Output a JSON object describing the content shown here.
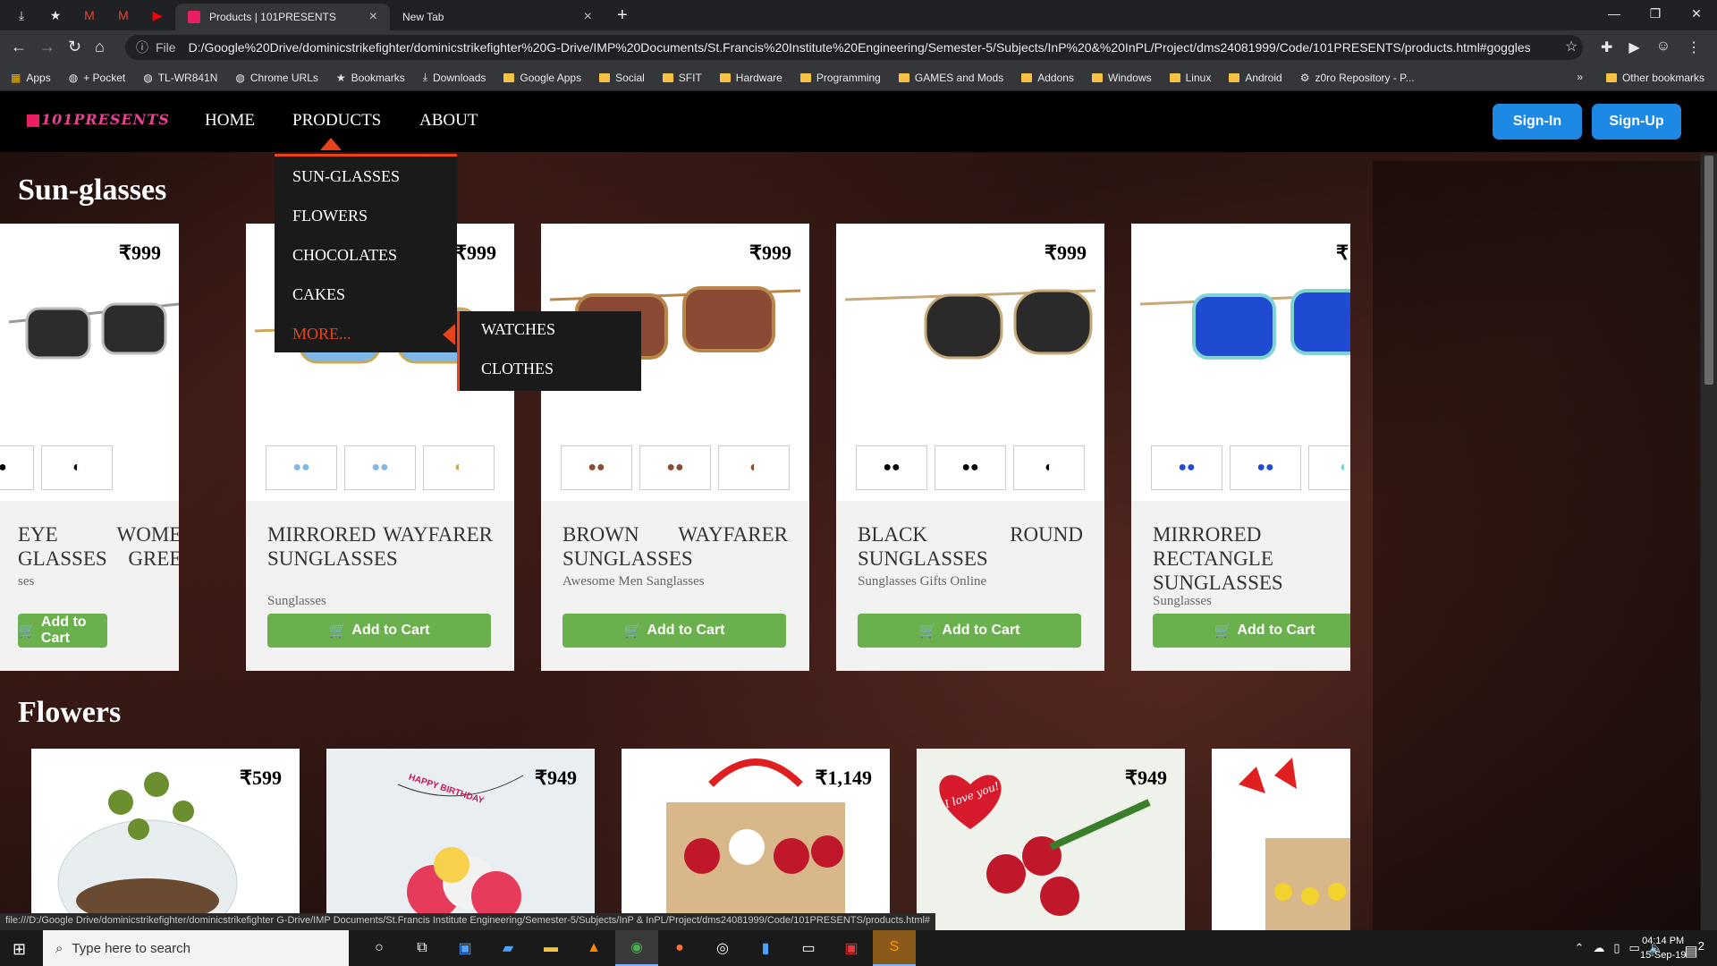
{
  "browser": {
    "tabs": [
      {
        "title": "Products | 101PRESENTS"
      },
      {
        "title": "New Tab"
      }
    ],
    "address": {
      "scheme_label": "File",
      "url": "D:/Google%20Drive/dominicstrikefighter/dominicstrikefighter%20G-Drive/IMP%20Documents/St.Francis%20Institute%20Engineering/Semester-5/Subjects/InP%20&%20InPL/Project/dms24081999/Code/101PRESENTS/products.html#goggles"
    },
    "bookmarks": [
      {
        "label": "Apps",
        "icon": "apps-grid-icon"
      },
      {
        "label": "+ Pocket",
        "icon": "globe-icon"
      },
      {
        "label": "TL-WR841N",
        "icon": "globe-icon"
      },
      {
        "label": "Chrome URLs",
        "icon": "globe-icon"
      },
      {
        "label": "Bookmarks",
        "icon": "star-icon"
      },
      {
        "label": "Downloads",
        "icon": "download-icon"
      },
      {
        "label": "Google Apps",
        "icon": "folder-icon"
      },
      {
        "label": "Social",
        "icon": "folder-icon"
      },
      {
        "label": "SFIT",
        "icon": "folder-icon"
      },
      {
        "label": "Hardware",
        "icon": "folder-icon"
      },
      {
        "label": "Programming",
        "icon": "folder-icon"
      },
      {
        "label": "GAMES and Mods",
        "icon": "folder-icon"
      },
      {
        "label": "Addons",
        "icon": "folder-icon"
      },
      {
        "label": "Windows",
        "icon": "folder-icon"
      },
      {
        "label": "Linux",
        "icon": "folder-icon"
      },
      {
        "label": "Android",
        "icon": "folder-icon"
      },
      {
        "label": "z0ro Repository - P...",
        "icon": "gear-icon"
      }
    ],
    "other_bookmarks": "Other bookmarks",
    "chevron": "»",
    "status_url": "file:///D:/Google Drive/dominicstrikefighter/dominicstrikefighter G-Drive/IMP Documents/St.Francis Institute Engineering/Semester-5/Subjects/InP & InPL/Project/dms24081999/Code/101PRESENTS/products.html#"
  },
  "site": {
    "logo": "101PRESENTS",
    "nav": {
      "home": "HOME",
      "products": "PRODUCTS",
      "about": "ABOUT"
    },
    "auth": {
      "signin": "Sign-In",
      "signup": "Sign-Up"
    },
    "dropdown": [
      "SUN-GLASSES",
      "FLOWERS",
      "CHOCOLATES",
      "CAKES",
      "MORE..."
    ],
    "submenu": [
      "WATCHES",
      "CLOTHES"
    ],
    "sections": {
      "sunglasses": {
        "title": "Sun-glasses",
        "cards": [
          {
            "price": "₹999",
            "title": "EYE WOMEN GLASSES GREEN",
            "sub": "ses",
            "cart": "Add to Cart"
          },
          {
            "price": "₹999",
            "title": "MIRRORED WAYFARER SUNGLASSES",
            "sub": "Sunglasses",
            "cart": "Add to Cart"
          },
          {
            "price": "₹999",
            "title": "BROWN WAYFARER SUNGLASSES",
            "sub": "Awesome Men Sanglasses",
            "cart": "Add to Cart"
          },
          {
            "price": "₹999",
            "title": "BLACK ROUND SUNGLASSES",
            "sub": "Sunglasses Gifts Online",
            "cart": "Add to Cart"
          },
          {
            "price": "₹",
            "title": "MIRRORED RECTANGLE SUNGLASSES",
            "sub": "Sunglasses",
            "cart": "Add to Cart"
          }
        ]
      },
      "flowers": {
        "title": "Flowers",
        "cards": [
          {
            "price": "₹599"
          },
          {
            "price": "₹949",
            "banner": "HAPPY BIRTHDAY"
          },
          {
            "price": "₹1,149"
          },
          {
            "price": "₹949",
            "heart_text": "I love you!"
          },
          {
            "price": ""
          }
        ]
      }
    }
  },
  "taskbar": {
    "search_placeholder": "Type here to search",
    "time": "04:14 PM",
    "date": "15-Sep-19",
    "notif_count": "2"
  },
  "colors": {
    "accent_orange": "#e8431a",
    "button_blue": "#1e88e5",
    "cart_green": "#6ab04c"
  }
}
